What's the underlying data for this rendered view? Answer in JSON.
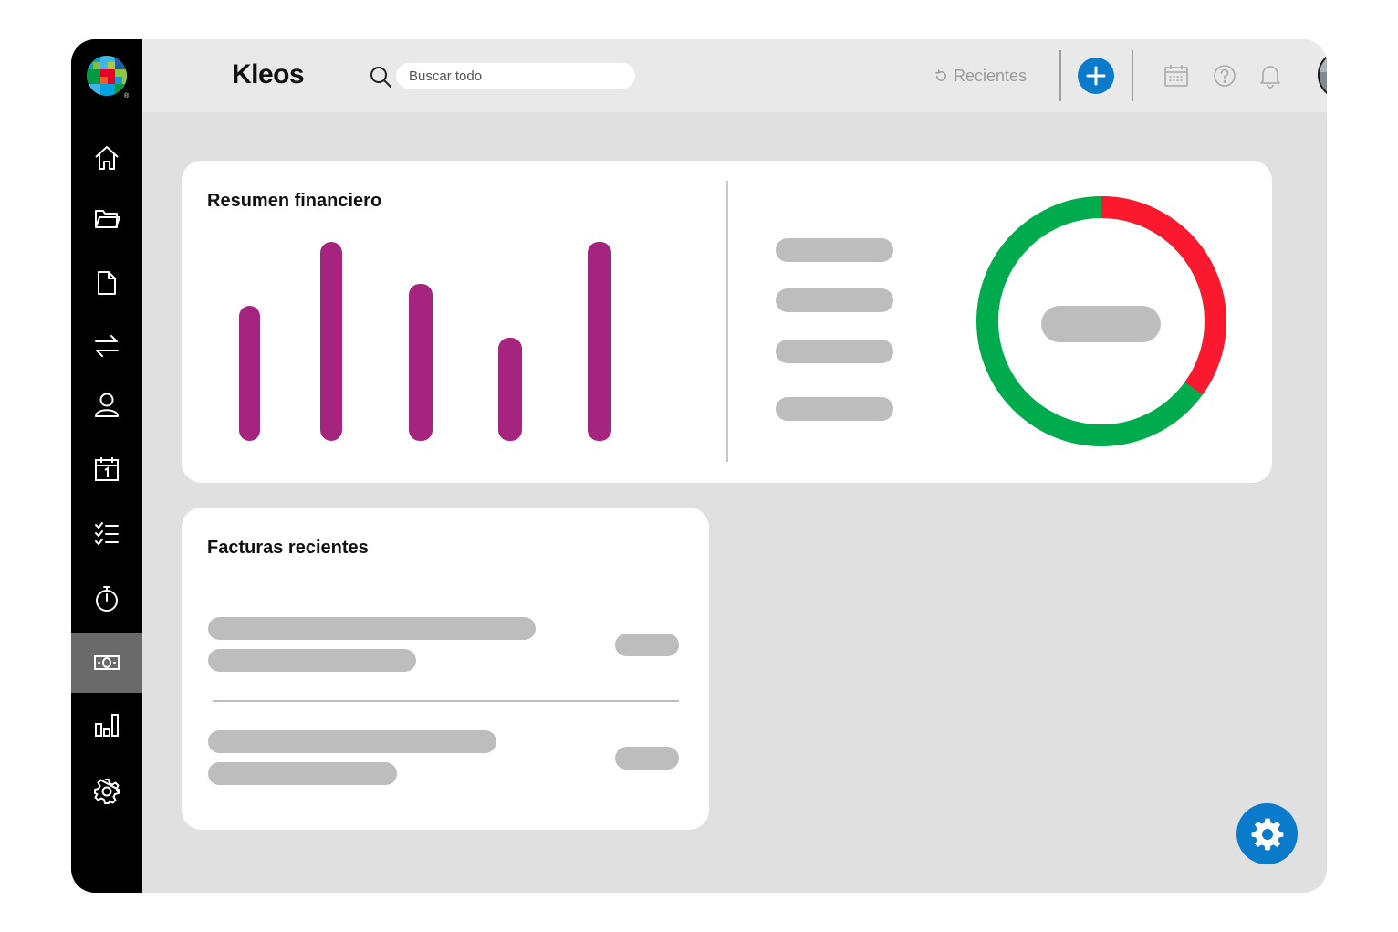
{
  "header": {
    "app_title": "Kleos",
    "search_placeholder": "Buscar todo",
    "recents_label": "Recientes"
  },
  "sidebar": {
    "items": [
      {
        "name": "home-icon",
        "active": false
      },
      {
        "name": "folder-icon",
        "active": false
      },
      {
        "name": "document-icon",
        "active": false
      },
      {
        "name": "transfer-arrows-icon",
        "active": false
      },
      {
        "name": "contact-person-icon",
        "active": false
      },
      {
        "name": "calendar-icon",
        "active": false
      },
      {
        "name": "task-list-icon",
        "active": false
      },
      {
        "name": "stopwatch-icon",
        "active": false
      },
      {
        "name": "billing-money-icon",
        "active": true
      },
      {
        "name": "reports-chart-icon",
        "active": false
      },
      {
        "name": "settings-gear-icon",
        "active": false
      }
    ]
  },
  "financial_summary": {
    "title": "Resumen financiero",
    "donut": {
      "red_fraction": 0.35,
      "green_fraction": 0.65
    }
  },
  "chart_data": {
    "type": "bar",
    "title": "Resumen financiero",
    "values": [
      0.68,
      1.0,
      0.79,
      0.52,
      1.0
    ],
    "ylim": [
      0,
      1
    ]
  },
  "recent_invoices": {
    "title": "Facturas recientes"
  },
  "colors": {
    "sidebar": "#000000",
    "accent_blue": "#0a7bcb",
    "bar_magenta": "#a5247e",
    "donut_green": "#00ab4e",
    "donut_red": "#fb1930",
    "placeholder_gray": "#bdbdbd"
  }
}
